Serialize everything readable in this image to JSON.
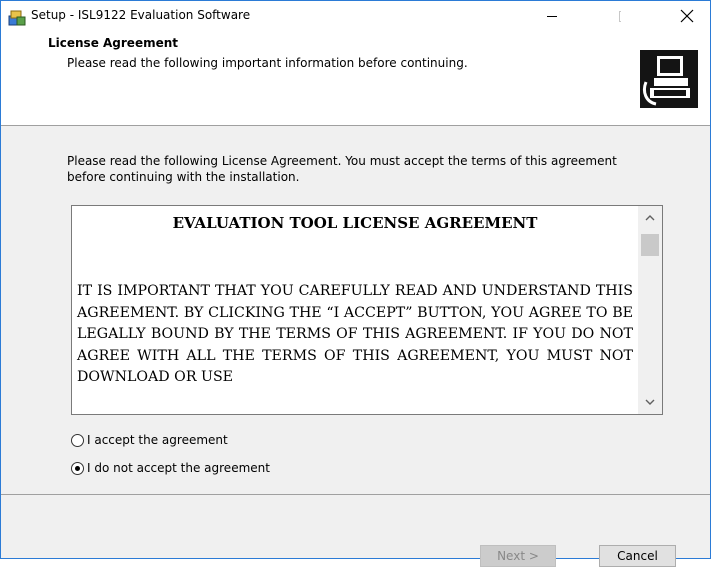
{
  "window": {
    "title": "Setup - ISL9122 Evaluation Software"
  },
  "header": {
    "title": "License Agreement",
    "subtitle": "Please read the following important information before continuing."
  },
  "intro_text": "Please read the following License Agreement. You must accept the terms of this agreement before continuing with the installation.",
  "license": {
    "heading": "EVALUATION TOOL LICENSE AGREEMENT",
    "body": "IT IS IMPORTANT THAT YOU CAREFULLY READ AND UNDERSTAND THIS AGREEMENT. BY CLICKING THE “I ACCEPT” BUTTON, YOU AGREE TO BE LEGALLY BOUND BY THE TERMS OF THIS AGREEMENT. IF YOU DO NOT AGREE WITH ALL THE TERMS OF THIS AGREEMENT, YOU MUST NOT DOWNLOAD OR USE"
  },
  "options": {
    "accept_label": "I accept the agreement",
    "decline_label": "I do not accept the agreement",
    "selected": "decline"
  },
  "buttons": {
    "next_label": "Next >",
    "cancel_label": "Cancel",
    "next_enabled": false
  },
  "icons": {
    "app": "installer-icon",
    "minimize": "minimize-icon",
    "maximize": "maximize-icon",
    "close": "close-icon",
    "header_image": "computer-install-icon",
    "scroll_up": "chevron-up-icon",
    "scroll_down": "chevron-down-icon"
  }
}
